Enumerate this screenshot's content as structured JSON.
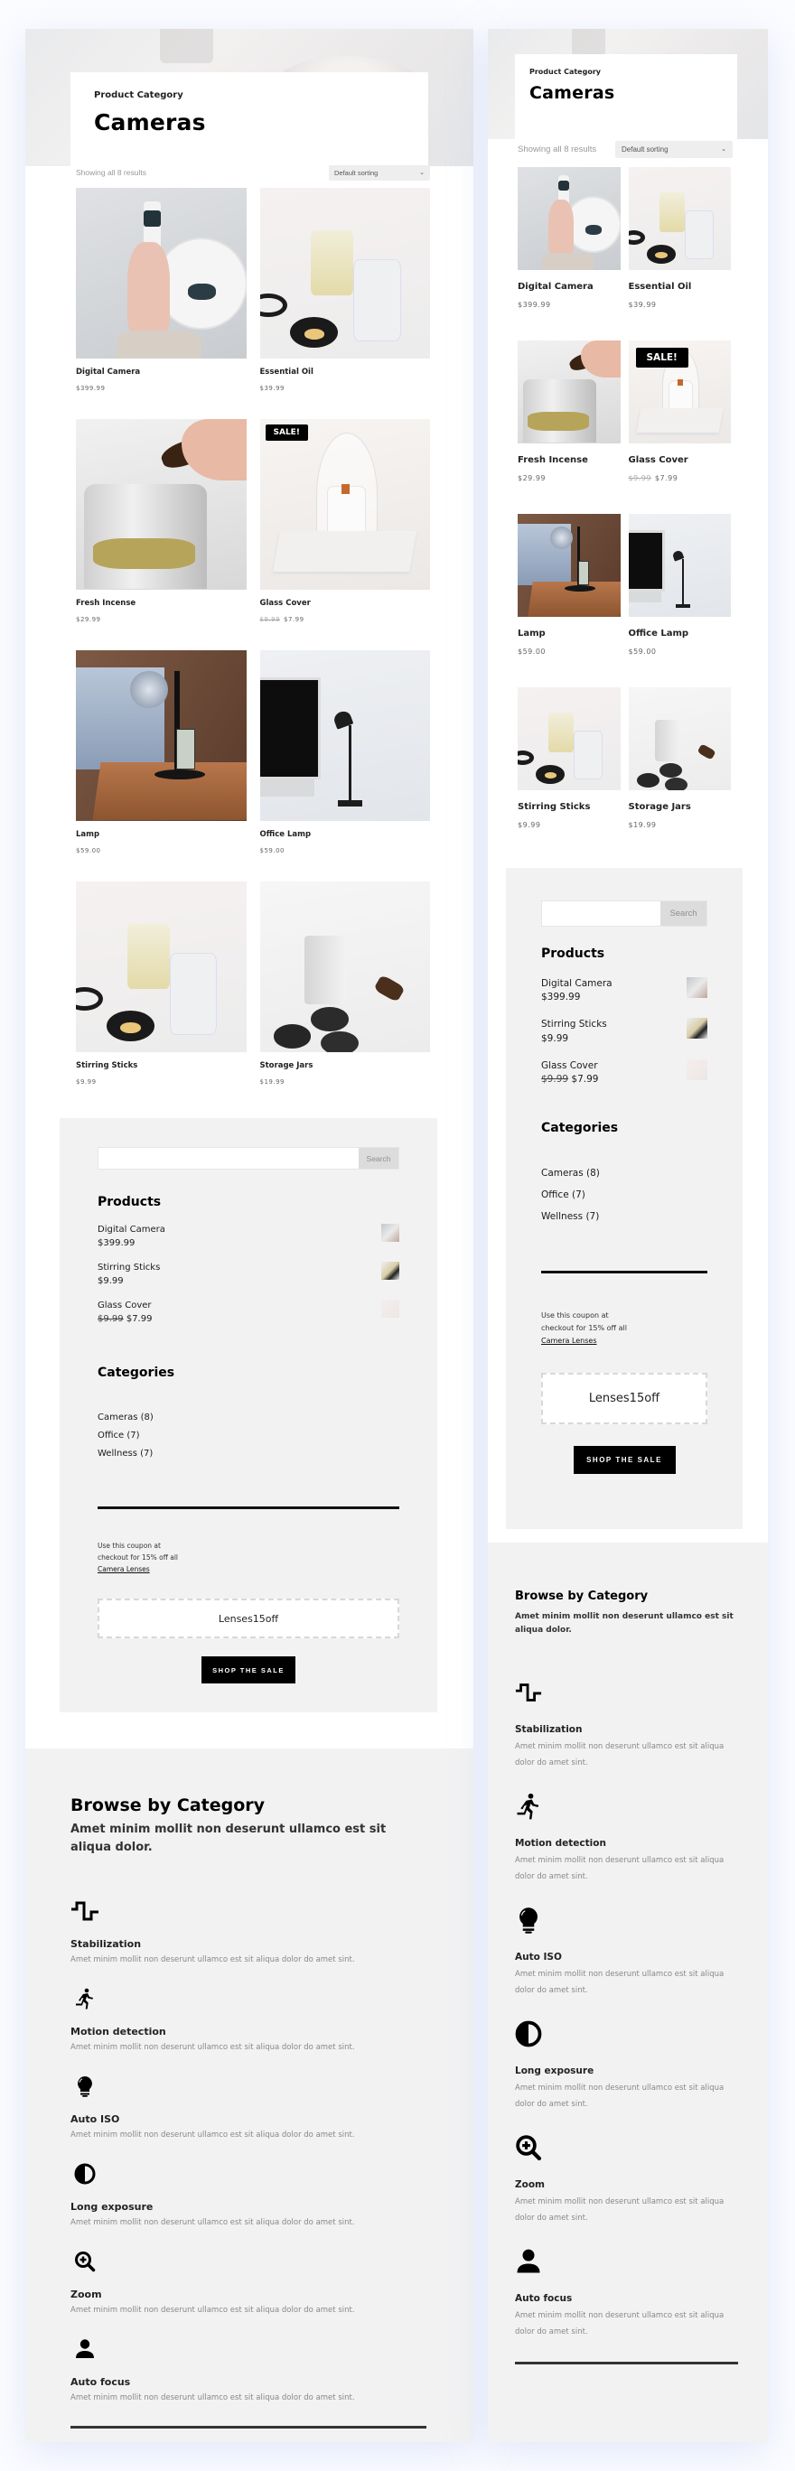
{
  "header": {
    "category_label": "Product Category",
    "title": "Cameras",
    "results_text": "Showing all 8 results",
    "sort": {
      "selected": "Default sorting"
    }
  },
  "products": [
    {
      "name": "Digital Camera",
      "price": "$399.99",
      "image": "img-camera"
    },
    {
      "name": "Essential Oil",
      "price": "$39.99",
      "image": "img-oil"
    },
    {
      "name": "Fresh Incense",
      "price": "$29.99",
      "image": "img-incense"
    },
    {
      "name": "Glass Cover",
      "old_price": "$9.99",
      "price": "$7.99",
      "badge": "SALE!",
      "image": "img-glass"
    },
    {
      "name": "Lamp",
      "price": "$59.00",
      "image": "img-lamp"
    },
    {
      "name": "Office Lamp",
      "price": "$59.00",
      "image": "img-office"
    },
    {
      "name": "Stirring Sticks",
      "price": "$9.99",
      "image": "img-oil"
    },
    {
      "name": "Storage Jars",
      "price": "$19.99",
      "image": "img-jars"
    }
  ],
  "sidebar": {
    "search": {
      "placeholder": "",
      "button": "Search"
    },
    "products_heading": "Products",
    "products": [
      {
        "name": "Digital Camera",
        "price": "$399.99",
        "thumb": "camera"
      },
      {
        "name": "Stirring Sticks",
        "price": "$9.99",
        "thumb": "stirring-sticks"
      },
      {
        "name": "Glass Cover",
        "old_price": "$9.99",
        "price": "$7.99",
        "thumb": "glass-cover"
      }
    ],
    "categories_heading": "Categories",
    "categories": [
      "Cameras (8)",
      "Office (7)",
      "Wellness (7)"
    ],
    "coupon": {
      "line1": "Use this coupon at",
      "line2": "checkout for 15% off all",
      "link": "Camera Lenses",
      "code": "Lenses15off",
      "button": "SHOP THE SALE"
    }
  },
  "browse": {
    "title": "Browse by Category",
    "subtitle": "Amet minim mollit non deserunt ullamco est sit aliqua dolor.",
    "features": [
      {
        "icon": "waveform-icon",
        "title": "Stabilization",
        "text": "Amet minim mollit non deserunt ullamco est sit aliqua dolor do amet sint."
      },
      {
        "icon": "running-person-icon",
        "title": "Motion detection",
        "text": "Amet minim mollit non deserunt ullamco est sit aliqua dolor do amet sint."
      },
      {
        "icon": "lightbulb-icon",
        "title": "Auto ISO",
        "text": "Amet minim mollit non deserunt ullamco est sit aliqua dolor do amet sint."
      },
      {
        "icon": "contrast-icon",
        "title": "Long exposure",
        "text": "Amet minim mollit non deserunt ullamco est sit aliqua dolor do amet sint."
      },
      {
        "icon": "zoom-in-icon",
        "title": "Zoom",
        "text": "Amet minim mollit non deserunt ullamco est sit aliqua dolor do amet sint."
      },
      {
        "icon": "person-icon",
        "title": "Auto focus",
        "text": "Amet minim mollit non deserunt ullamco est sit aliqua dolor do amet sint."
      }
    ]
  }
}
